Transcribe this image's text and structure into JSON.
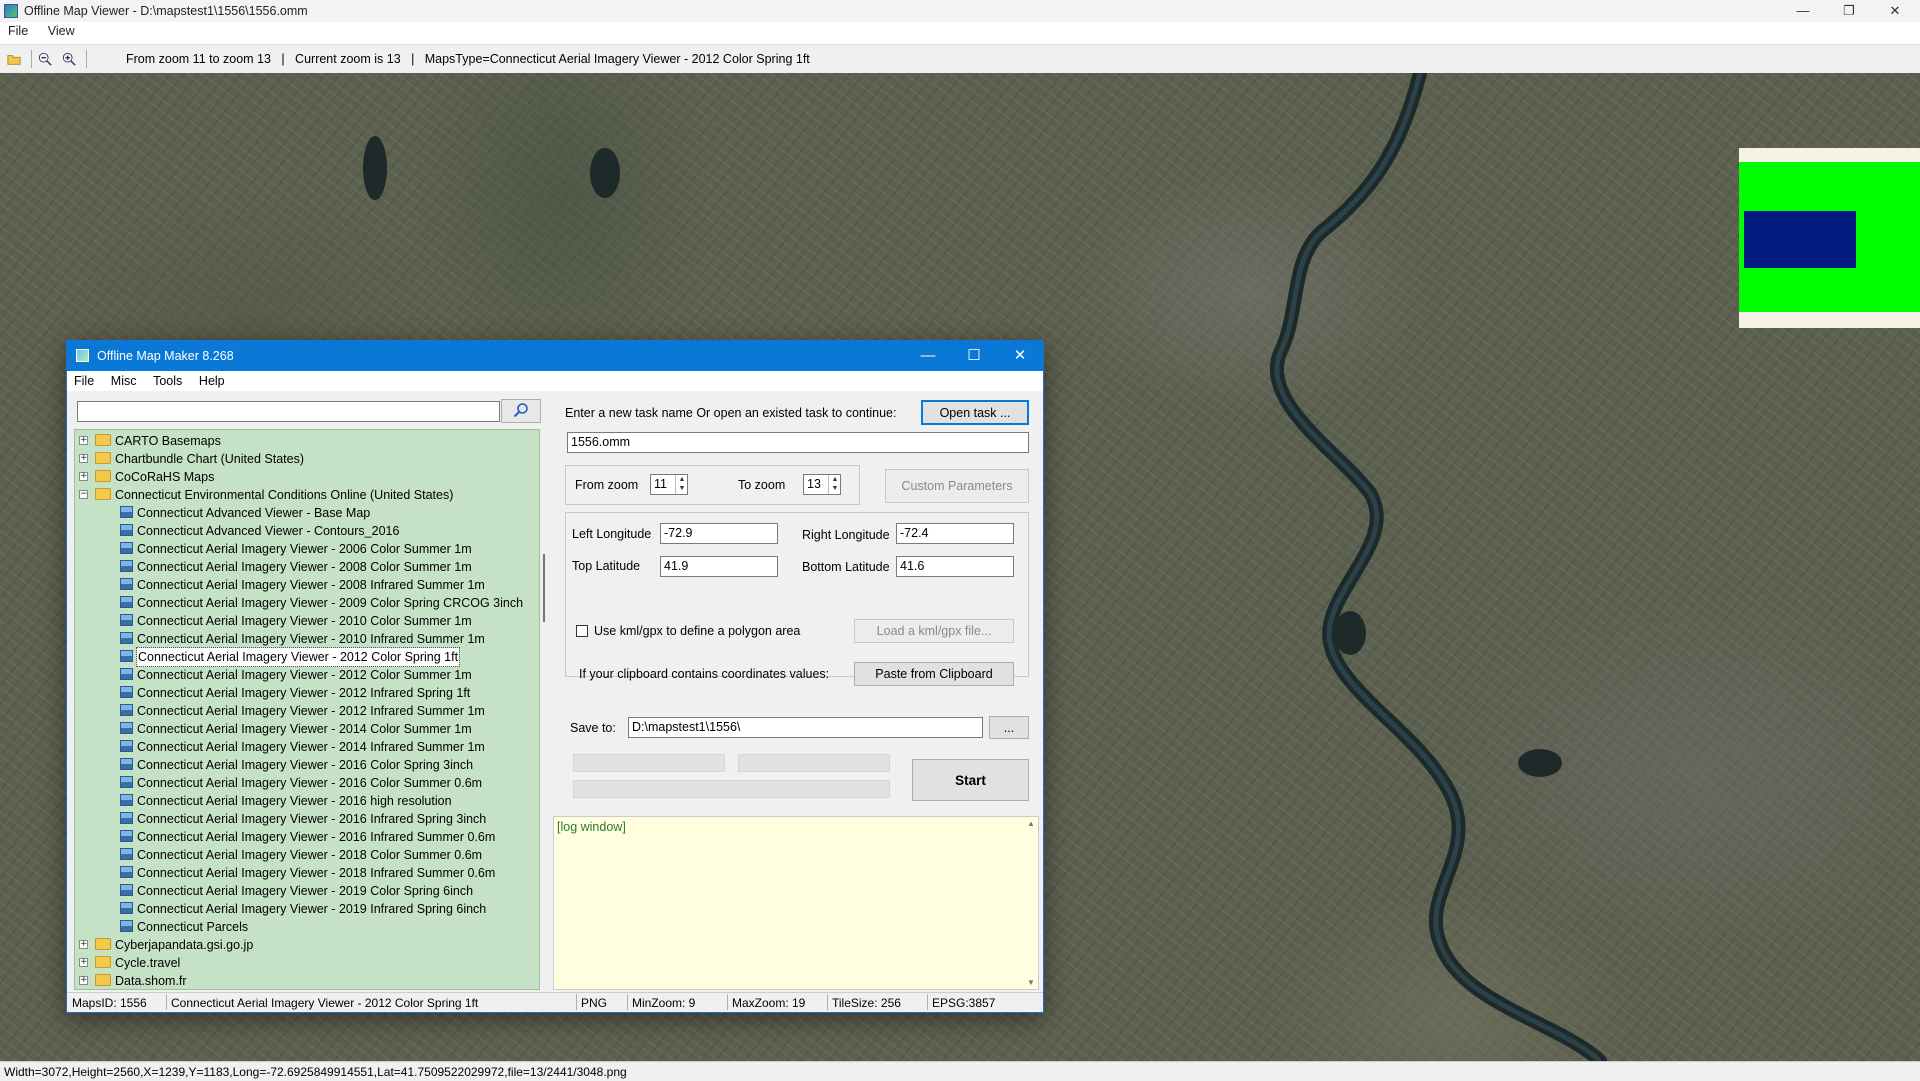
{
  "window": {
    "title": "Offline Map Viewer - D:\\mapstest1\\1556\\1556.omm",
    "controls": {
      "minimize": "—",
      "maximize": "❐",
      "close": "✕"
    }
  },
  "menu": {
    "file": "File",
    "view": "View"
  },
  "toolbar": {
    "zoom_range": "From zoom 11 to zoom 13   |   Current zoom is 13   |   MapsType=Connecticut Aerial Imagery Viewer - 2012 Color Spring 1ft",
    "icons": [
      "open-folder-icon",
      "zoom-out-icon",
      "zoom-in-icon"
    ]
  },
  "statusbar": {
    "text": "Width=3072,Height=2560,X=1239,Y=1183,Long=-72.6925849914551,Lat=41.7509522029972,file=13/2441/3048.png"
  },
  "overview": {
    "colors": {
      "background": "#00ff00",
      "viewport": "#001b80"
    }
  },
  "dialog": {
    "title": "Offline Map Maker 8.268",
    "menu": [
      "File",
      "Misc",
      "Tools",
      "Help"
    ],
    "search": {
      "value": ""
    },
    "tree": [
      {
        "label": "CARTO Basemaps",
        "type": "folder",
        "expanded": false
      },
      {
        "label": "Chartbundle Chart (United States)",
        "type": "folder",
        "expanded": false
      },
      {
        "label": "CoCoRaHS Maps",
        "type": "folder",
        "expanded": false
      },
      {
        "label": "Connecticut Environmental Conditions Online (United States)",
        "type": "folder",
        "expanded": true
      },
      {
        "label": "Connecticut Advanced Viewer - Base Map",
        "type": "map"
      },
      {
        "label": "Connecticut Advanced Viewer - Contours_2016",
        "type": "map"
      },
      {
        "label": "Connecticut Aerial Imagery Viewer - 2006 Color Summer 1m",
        "type": "map"
      },
      {
        "label": "Connecticut Aerial Imagery Viewer - 2008 Color Summer 1m",
        "type": "map"
      },
      {
        "label": "Connecticut Aerial Imagery Viewer - 2008 Infrared Summer 1m",
        "type": "map"
      },
      {
        "label": "Connecticut Aerial Imagery Viewer - 2009 Color Spring CRCOG 3inch",
        "type": "map"
      },
      {
        "label": "Connecticut Aerial Imagery Viewer - 2010 Color Summer 1m",
        "type": "map"
      },
      {
        "label": "Connecticut Aerial Imagery Viewer - 2010 Infrared Summer 1m",
        "type": "map"
      },
      {
        "label": "Connecticut Aerial Imagery Viewer - 2012 Color Spring 1ft",
        "type": "map",
        "selected": true
      },
      {
        "label": "Connecticut Aerial Imagery Viewer - 2012 Color Summer 1m",
        "type": "map"
      },
      {
        "label": "Connecticut Aerial Imagery Viewer - 2012 Infrared Spring 1ft",
        "type": "map"
      },
      {
        "label": "Connecticut Aerial Imagery Viewer - 2012 Infrared Summer 1m",
        "type": "map"
      },
      {
        "label": "Connecticut Aerial Imagery Viewer - 2014 Color Summer 1m",
        "type": "map"
      },
      {
        "label": "Connecticut Aerial Imagery Viewer - 2014 Infrared Summer 1m",
        "type": "map"
      },
      {
        "label": "Connecticut Aerial Imagery Viewer - 2016 Color Spring 3inch",
        "type": "map"
      },
      {
        "label": "Connecticut Aerial Imagery Viewer - 2016 Color Summer 0.6m",
        "type": "map"
      },
      {
        "label": "Connecticut Aerial Imagery Viewer - 2016 high resolution",
        "type": "map"
      },
      {
        "label": "Connecticut Aerial Imagery Viewer - 2016 Infrared Spring 3inch",
        "type": "map"
      },
      {
        "label": "Connecticut Aerial Imagery Viewer - 2016 Infrared Summer 0.6m",
        "type": "map"
      },
      {
        "label": "Connecticut Aerial Imagery Viewer - 2018 Color Summer 0.6m",
        "type": "map"
      },
      {
        "label": "Connecticut Aerial Imagery Viewer - 2018 Infrared Summer 0.6m",
        "type": "map"
      },
      {
        "label": "Connecticut Aerial Imagery Viewer - 2019 Color Spring 6inch",
        "type": "map"
      },
      {
        "label": "Connecticut Aerial Imagery Viewer - 2019 Infrared Spring 6inch",
        "type": "map"
      },
      {
        "label": "Connecticut Parcels",
        "type": "map"
      },
      {
        "label": "Cyberjapandata.gsi.go.jp",
        "type": "folder",
        "expanded": false
      },
      {
        "label": "Cycle.travel",
        "type": "folder",
        "expanded": false
      },
      {
        "label": "Data.shom.fr",
        "type": "folder",
        "expanded": false
      }
    ],
    "task": {
      "prompt": "Enter a new task name Or open an existed task to continue:",
      "open_button": "Open task ...",
      "name_value": "1556.omm"
    },
    "zoom": {
      "from_label": "From zoom",
      "from_value": "11",
      "to_label": "To zoom",
      "to_value": "13",
      "custom_button": "Custom Parameters"
    },
    "coords": {
      "left_lon_label": "Left Longitude",
      "left_lon": "-72.9",
      "right_lon_label": "Right Longitude",
      "right_lon": "-72.4",
      "top_lat_label": "Top Latitude",
      "top_lat": "41.9",
      "bottom_lat_label": "Bottom Latitude",
      "bottom_lat": "41.6",
      "kml_label": "Use kml/gpx to define a polygon area",
      "kml_button": "Load a kml/gpx file...",
      "clipboard_label": "If your clipboard contains coordinates values:",
      "clipboard_button": "Paste from Clipboard"
    },
    "save": {
      "label": "Save to:",
      "path": "D:\\mapstest1\\1556\\",
      "browse": "..."
    },
    "start_button": "Start",
    "log": {
      "header": "[log window]"
    },
    "status": {
      "maps_id": "MapsID: 1556",
      "maps_name": "Connecticut Aerial Imagery Viewer - 2012 Color Spring 1ft",
      "format": "PNG",
      "min_zoom": "MinZoom: 9",
      "max_zoom": "MaxZoom: 19",
      "tile_size": "TileSize: 256",
      "epsg": "EPSG:3857"
    }
  }
}
